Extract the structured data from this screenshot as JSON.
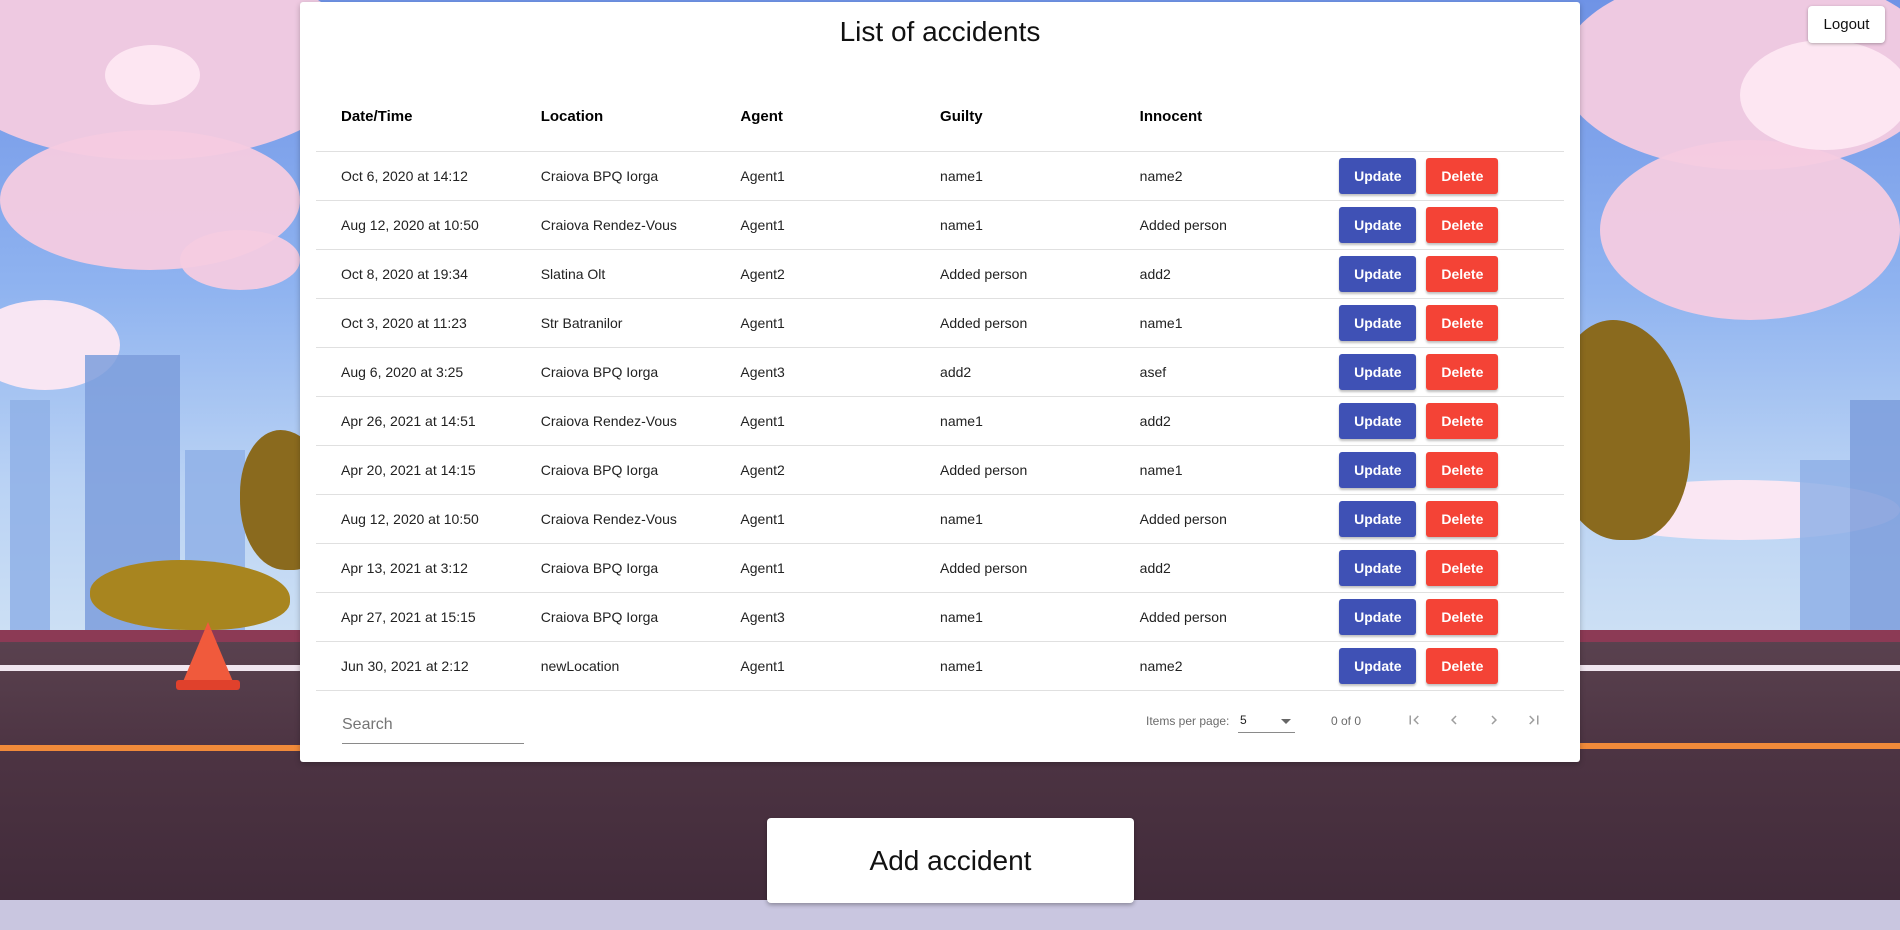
{
  "header": {
    "logout_label": "Logout"
  },
  "card": {
    "title": "List of accidents",
    "columns": [
      "Date/Time",
      "Location",
      "Agent",
      "Guilty",
      "Innocent"
    ],
    "rows": [
      {
        "datetime": "Oct 6, 2020 at 14:12",
        "location": "Craiova BPQ Iorga",
        "agent": "Agent1",
        "guilty": "name1",
        "innocent": "name2"
      },
      {
        "datetime": "Aug 12, 2020 at 10:50",
        "location": "Craiova Rendez-Vous",
        "agent": "Agent1",
        "guilty": "name1",
        "innocent": "Added person"
      },
      {
        "datetime": "Oct 8, 2020 at 19:34",
        "location": "Slatina Olt",
        "agent": "Agent2",
        "guilty": "Added person",
        "innocent": "add2"
      },
      {
        "datetime": "Oct 3, 2020 at 11:23",
        "location": "Str Batranilor",
        "agent": "Agent1",
        "guilty": "Added person",
        "innocent": "name1"
      },
      {
        "datetime": "Aug 6, 2020 at 3:25",
        "location": "Craiova BPQ Iorga",
        "agent": "Agent3",
        "guilty": "add2",
        "innocent": "asef"
      },
      {
        "datetime": "Apr 26, 2021 at 14:51",
        "location": "Craiova Rendez-Vous",
        "agent": "Agent1",
        "guilty": "name1",
        "innocent": "add2"
      },
      {
        "datetime": "Apr 20, 2021 at 14:15",
        "location": "Craiova BPQ Iorga",
        "agent": "Agent2",
        "guilty": "Added person",
        "innocent": "name1"
      },
      {
        "datetime": "Aug 12, 2020 at 10:50",
        "location": "Craiova Rendez-Vous",
        "agent": "Agent1",
        "guilty": "name1",
        "innocent": "Added person"
      },
      {
        "datetime": "Apr 13, 2021 at 3:12",
        "location": "Craiova BPQ Iorga",
        "agent": "Agent1",
        "guilty": "Added person",
        "innocent": "add2"
      },
      {
        "datetime": "Apr 27, 2021 at 15:15",
        "location": "Craiova BPQ Iorga",
        "agent": "Agent3",
        "guilty": "name1",
        "innocent": "Added person"
      },
      {
        "datetime": "Jun 30, 2021 at 2:12",
        "location": "newLocation",
        "agent": "Agent1",
        "guilty": "name1",
        "innocent": "name2"
      }
    ],
    "update_label": "Update",
    "delete_label": "Delete",
    "colors": {
      "update": "#3f51b5",
      "delete": "#f44336"
    }
  },
  "footer": {
    "search_placeholder": "Search",
    "items_per_page_label": "Items per page:",
    "items_per_page_value": "5",
    "range_label": "0 of 0",
    "nav_icons": [
      "first-page-icon",
      "previous-page-icon",
      "next-page-icon",
      "last-page-icon"
    ]
  },
  "add_button_label": "Add accident"
}
